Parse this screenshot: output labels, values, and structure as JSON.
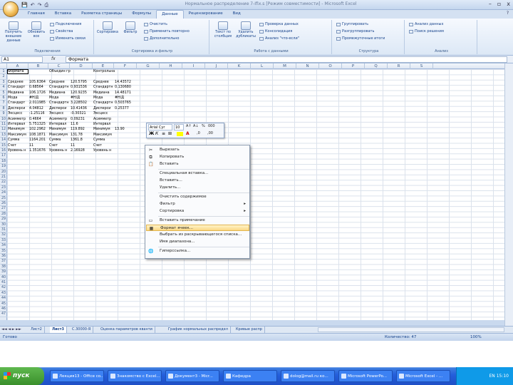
{
  "window": {
    "title": "Нормальное распределение 7-Ifix.s [Режим совместимости] - Microsoft Excel",
    "controls": [
      "–",
      "▫",
      "x"
    ]
  },
  "qat": [
    "💾",
    "↶",
    "↷",
    "⎙"
  ],
  "ribbon": {
    "tabs": [
      "Главная",
      "Вставка",
      "Разметка страницы",
      "Формулы",
      "Данные",
      "Рецензирование",
      "Вид"
    ],
    "active_tab": "Данные",
    "help": "?",
    "groups": [
      {
        "label": "Подключения",
        "big": [
          "Получить внешние данные",
          "Обновить все"
        ],
        "small": [
          "Подключения",
          "Свойства",
          "Изменить связи"
        ]
      },
      {
        "label": "Сортировка и фильтр",
        "big": [
          "Сортировка",
          "Фильтр"
        ],
        "small": [
          "Очистить",
          "Применить повторно",
          "Дополнительно"
        ]
      },
      {
        "label": "Работа с данными",
        "big": [
          "Текст по столбцам",
          "Удалить дубликаты"
        ],
        "small": [
          "Проверка данных",
          "Консолидация",
          "Анализ \"что-если\""
        ]
      },
      {
        "label": "Структура",
        "small": [
          "Группировать",
          "Разгруппировать",
          "Промежуточные итоги"
        ]
      },
      {
        "label": "Анализ",
        "small": [
          "Анализ данных",
          "Поиск решения"
        ]
      }
    ]
  },
  "formula_bar": {
    "name_box": "A1",
    "fx": "fx",
    "value": "Формата"
  },
  "columns": [
    "A",
    "B",
    "C",
    "D",
    "E",
    "F",
    "G",
    "H",
    "I",
    "J",
    "K",
    "L",
    "M",
    "N",
    "O",
    "P",
    "Q",
    "R",
    "S"
  ],
  "rows_count": 47,
  "table": {
    "header": [
      "Формата",
      "",
      "Объедин групп",
      "",
      "Контрольная точ",
      "",
      ""
    ],
    "rows": [
      [
        "",
        "",
        "",
        "",
        "",
        ""
      ],
      [
        "Среднее",
        "105.6364",
        "Среднее",
        "120.5795",
        "Среднее",
        "14.43572"
      ],
      [
        "Стандарт",
        "0.68564",
        "Стандартн",
        "0.931536",
        "Стандартн",
        "0.130680"
      ],
      [
        "Медиана",
        "106.1726",
        "Медиана",
        "120.9235",
        "Медиана",
        "14.48171"
      ],
      [
        "Мода",
        "#Н/Д",
        "Мода",
        "#Н/Д",
        "Мода",
        "#Н/Д"
      ],
      [
        "Стандарт",
        "2.011985",
        "Стандартн",
        "3.228502",
        "Стандартн",
        "0.503765"
      ],
      [
        "Дисперси",
        "4.04812",
        "Дисперси",
        "10.41436",
        "Дисперси",
        "0.25377"
      ],
      [
        "Эксцесс",
        "-1.25116",
        "Эксцесс",
        "-0.30321",
        "Эксцесс",
        ""
      ],
      [
        "Асимметр",
        "0.4664",
        "Асимметр",
        "0.09231",
        "Асимметр",
        ""
      ],
      [
        "Интервал",
        "5.751325",
        "Интервал",
        "11.6",
        "Интервал",
        ""
      ],
      [
        "Минимум",
        "102.2962",
        "Минимум",
        "119.892",
        "Минимум",
        "13.90"
      ],
      [
        "Максимум",
        "108.1871",
        "Максимум",
        "131.78",
        "Максимум",
        ""
      ],
      [
        "Сумма",
        "1164.201",
        "Сумма",
        "1361.8",
        "Сумма",
        ""
      ],
      [
        "Счет",
        "11",
        "Счет",
        "11",
        "Счет",
        ""
      ],
      [
        "Уровень н",
        "1.351676",
        "Уровень н",
        "2.16928",
        "Уровень н",
        ""
      ]
    ]
  },
  "mini_toolbar": {
    "font": "Arial Cyr",
    "size": "10",
    "buttons": [
      "A↑",
      "A↓",
      "%",
      "000",
      "Ж",
      "К",
      "≡",
      "⊞",
      ",0",
      ",00"
    ]
  },
  "context_menu": {
    "items": [
      {
        "label": "Вырезать",
        "icon": "✂"
      },
      {
        "label": "Копировать",
        "icon": "⧉"
      },
      {
        "label": "Вставить",
        "icon": "📋"
      },
      {
        "label": "Специальная вставка...",
        "icon": ""
      },
      {
        "label": "Вставить...",
        "icon": ""
      },
      {
        "label": "Удалить...",
        "icon": ""
      },
      {
        "label": "Очистить содержимое",
        "icon": ""
      },
      {
        "label": "Фильтр",
        "icon": "",
        "submenu": true
      },
      {
        "label": "Сортировка",
        "icon": "",
        "submenu": true
      },
      {
        "label": "Вставить примечание",
        "icon": "▭"
      },
      {
        "label": "Формат ячеек...",
        "icon": "▦",
        "highlighted": true
      },
      {
        "label": "Выбрать из раскрывающегося списка...",
        "icon": ""
      },
      {
        "label": "Имя диапазона...",
        "icon": ""
      },
      {
        "label": "Гиперссылка...",
        "icon": "🌐"
      }
    ]
  },
  "sheet_tabs": [
    {
      "label": "Лист2"
    },
    {
      "label": "Лист3",
      "active": true
    },
    {
      "label": "С.30000-Я"
    },
    {
      "label": "Оценка параметров кванти"
    },
    {
      "label": "График нормальных распредел"
    },
    {
      "label": "Кривые распр"
    }
  ],
  "status": {
    "left": "Готово",
    "count": "Количество: 47",
    "zoom": "100%"
  },
  "taskbar": {
    "start": "пуск",
    "items": [
      "Лекция13 - Office co...",
      "Знакомство с Excel...",
      "Документ3 - Micr...",
      "Кафедра",
      "dolog@mail.ru ко...",
      "Microsoft PowerPo...",
      "Microsoft Excel - ..."
    ],
    "lang": "EN",
    "clock": "15:10"
  }
}
